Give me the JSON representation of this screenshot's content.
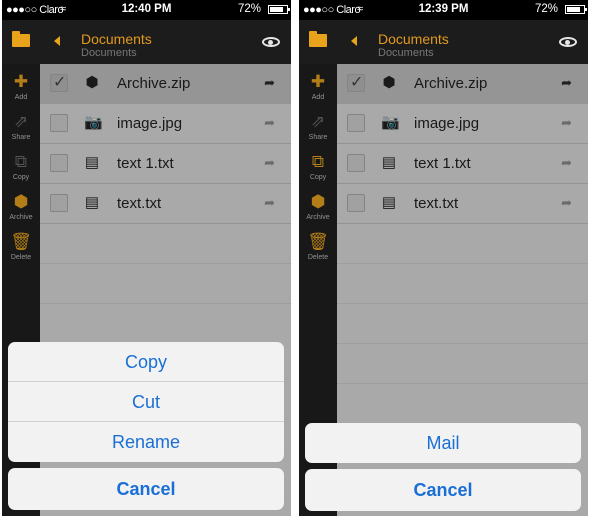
{
  "screens": [
    {
      "status": {
        "carrier": "Claro",
        "time": "12:40 PM",
        "battery": "72%"
      },
      "nav": {
        "title": "Documents",
        "subtitle": "Documents"
      },
      "sidebar": [
        {
          "label": "Add",
          "icon": "plus-icon",
          "enabled": true
        },
        {
          "label": "Share",
          "icon": "share-icon",
          "enabled": false
        },
        {
          "label": "Copy",
          "icon": "copy-icon",
          "enabled": false
        },
        {
          "label": "Archive",
          "icon": "archive-icon",
          "enabled": true
        },
        {
          "label": "Delete",
          "icon": "trash-icon",
          "enabled": true
        }
      ],
      "files": [
        {
          "name": "Archive.zip",
          "icon": "archive-icon",
          "selected": true
        },
        {
          "name": "image.jpg",
          "icon": "camera-icon",
          "selected": false
        },
        {
          "name": "text 1.txt",
          "icon": "document-icon",
          "selected": false
        },
        {
          "name": "text.txt",
          "icon": "document-icon",
          "selected": false
        }
      ],
      "action_sheet": {
        "options": [
          "Copy",
          "Cut",
          "Rename"
        ],
        "cancel": "Cancel"
      }
    },
    {
      "status": {
        "carrier": "Claro",
        "time": "12:39 PM",
        "battery": "72%"
      },
      "nav": {
        "title": "Documents",
        "subtitle": "Documents"
      },
      "sidebar": [
        {
          "label": "Add",
          "icon": "plus-icon",
          "enabled": true
        },
        {
          "label": "Share",
          "icon": "share-icon",
          "enabled": false
        },
        {
          "label": "Copy",
          "icon": "copy-icon",
          "enabled": true
        },
        {
          "label": "Archive",
          "icon": "archive-icon",
          "enabled": true
        },
        {
          "label": "Delete",
          "icon": "trash-icon",
          "enabled": true
        }
      ],
      "files": [
        {
          "name": "Archive.zip",
          "icon": "archive-icon",
          "selected": true
        },
        {
          "name": "image.jpg",
          "icon": "camera-icon",
          "selected": false
        },
        {
          "name": "text 1.txt",
          "icon": "document-icon",
          "selected": false
        },
        {
          "name": "text.txt",
          "icon": "document-icon",
          "selected": false
        }
      ],
      "action_sheet": {
        "options": [
          "Mail"
        ],
        "cancel": "Cancel"
      }
    }
  ],
  "colors": {
    "accent": "#e29a1c",
    "action_blue": "#1a6fd6"
  }
}
